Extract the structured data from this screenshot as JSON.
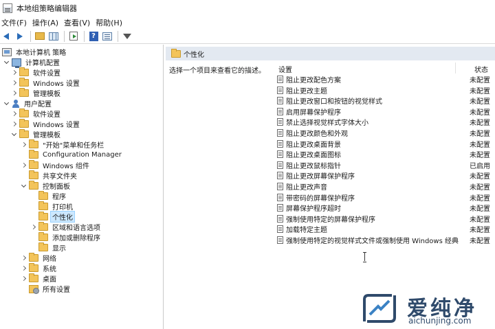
{
  "window": {
    "title": "本地组策略编辑器"
  },
  "menu": [
    "文件(F)",
    "操作(A)",
    "查看(V)",
    "帮助(H)"
  ],
  "toolbar": {
    "icons": [
      "back-arrow-icon",
      "forward-arrow-icon",
      "folder-up-icon",
      "show-hide-tree-icon",
      "export-list-icon",
      "help-icon",
      "properties-icon",
      "filter-icon"
    ],
    "help_glyph": "?"
  },
  "tree": {
    "root": "本地计算机 策略",
    "computer_config": "计算机配置",
    "computer_children": [
      "软件设置",
      "Windows 设置",
      "管理模板"
    ],
    "user_config": "用户配置",
    "user_children": [
      "软件设置",
      "Windows 设置",
      "管理模板"
    ],
    "admin_templates_children": [
      "\"开始\"菜单和任务栏",
      "Configuration Manager",
      "Windows 组件",
      "共享文件夹",
      "控制面板"
    ],
    "control_panel_children": [
      "程序",
      "打印机",
      "个性化",
      "区域和语言选项",
      "添加或删除程序",
      "显示"
    ],
    "tail_children": [
      "网络",
      "系统",
      "桌面",
      "所有设置"
    ],
    "selected": "个性化"
  },
  "details": {
    "header": "个性化",
    "description": "选择一个项目来查看它的描述。",
    "columns": {
      "setting": "设置",
      "state": "状态"
    },
    "rows": [
      {
        "name": "阻止更改配色方案",
        "state": "未配置"
      },
      {
        "name": "阻止更改主题",
        "state": "未配置"
      },
      {
        "name": "阻止更改窗口和按钮的视觉样式",
        "state": "未配置"
      },
      {
        "name": "启用屏幕保护程序",
        "state": "未配置"
      },
      {
        "name": "禁止选择视觉样式字体大小",
        "state": "未配置"
      },
      {
        "name": "阻止更改颜色和外观",
        "state": "未配置"
      },
      {
        "name": "阻止更改桌面背景",
        "state": "未配置"
      },
      {
        "name": "阻止更改桌面图标",
        "state": "未配置"
      },
      {
        "name": "阻止更改鼠标指针",
        "state": "已启用"
      },
      {
        "name": "阻止更改屏幕保护程序",
        "state": "未配置"
      },
      {
        "name": "阻止更改声音",
        "state": "未配置"
      },
      {
        "name": "带密码的屏幕保护程序",
        "state": "未配置"
      },
      {
        "name": "屏幕保护程序超时",
        "state": "未配置"
      },
      {
        "name": "强制使用特定的屏幕保护程序",
        "state": "未配置"
      },
      {
        "name": "加载特定主题",
        "state": "未配置"
      },
      {
        "name": "强制使用特定的视觉样式文件或强制使用 Windows 经典",
        "state": "未配置"
      }
    ]
  },
  "watermark": {
    "text": "爱纯净",
    "url": "aichunjing.com"
  },
  "colors": {
    "accent": "#2b6cb8",
    "selected": "#cce8ff",
    "header_band": "#e3e9f1",
    "folder": "#f3c45a",
    "watermark": "#2f4a6b"
  }
}
